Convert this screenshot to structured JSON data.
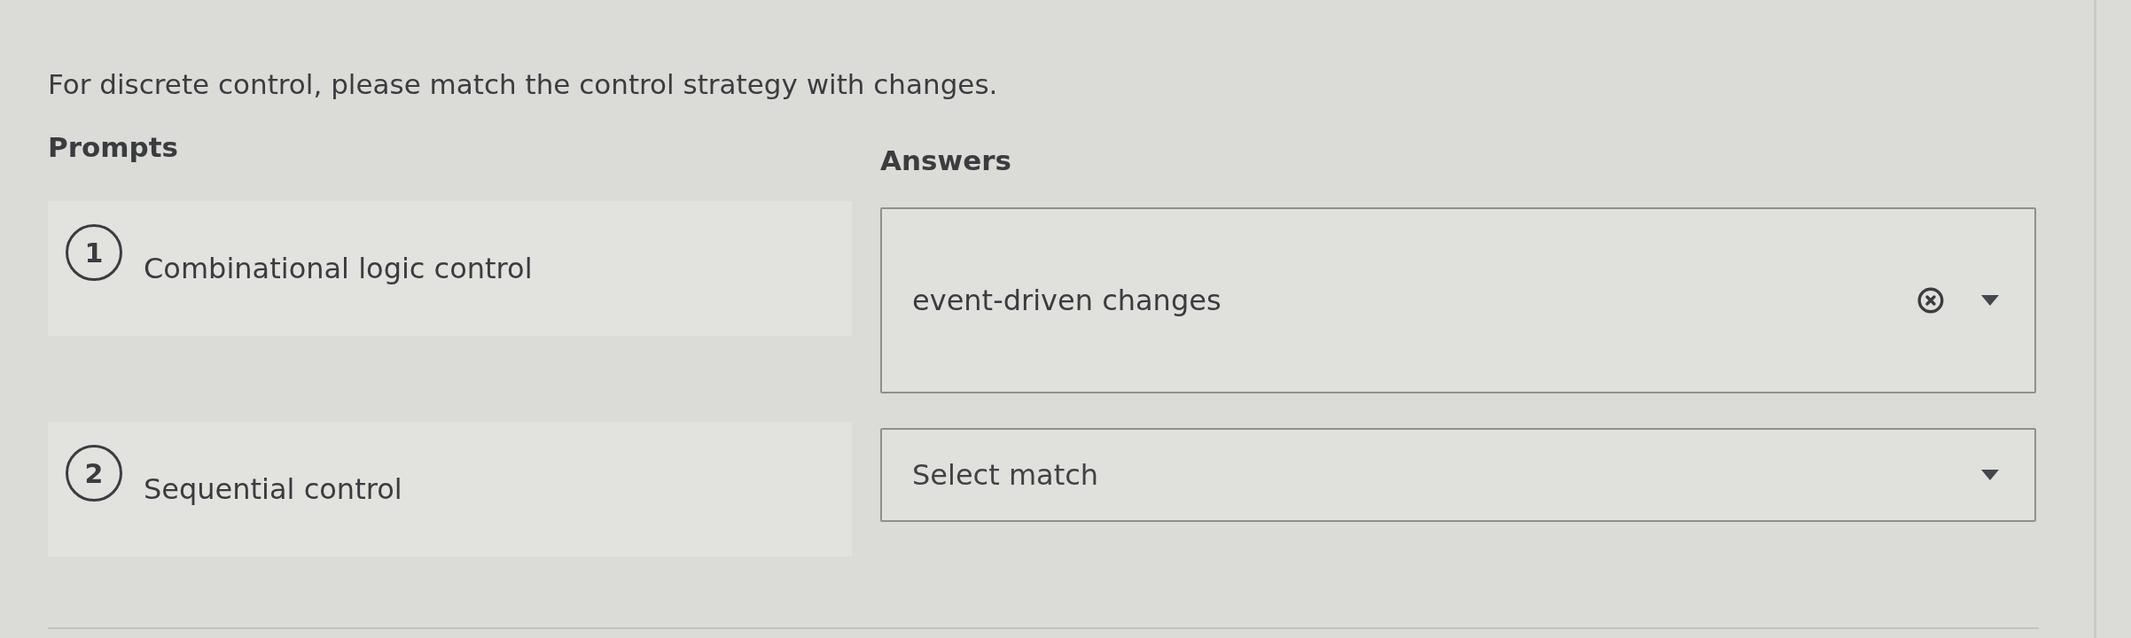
{
  "question": "For discrete control, please match the control strategy with changes.",
  "prompts_heading": "Prompts",
  "answers_heading": "Answers",
  "matches": [
    {
      "number": "1",
      "prompt": "Combinational logic control",
      "answer": {
        "value": "event-driven changes"
      }
    },
    {
      "number": "2",
      "prompt": "Sequential control",
      "answer": {
        "placeholder": "Select match"
      }
    }
  ]
}
